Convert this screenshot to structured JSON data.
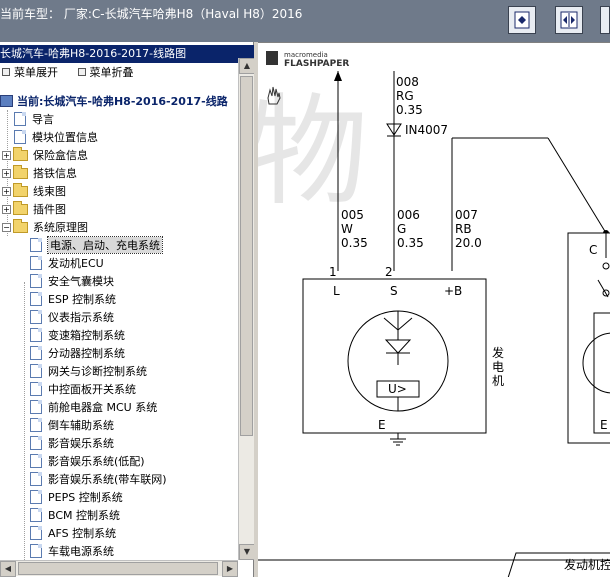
{
  "header": {
    "car_model": "当前车型： 厂家:C-长城汽车哈弗H8（Haval H8）2016"
  },
  "left_panel": {
    "title": "长城汽车-哈弗H8-2016-2017-线路图",
    "menu": {
      "expand_label": "菜单展开",
      "collapse_label": "菜单折叠"
    },
    "tree": {
      "root": "当前:长城汽车-哈弗H8-2016-2017-线路",
      "items": [
        "导言",
        "模块位置信息"
      ],
      "folders": [
        "保险盒信息",
        "搭铁信息",
        "线束图",
        "插件图",
        "系统原理图"
      ],
      "systems": [
        "电源、启动、充电系统",
        "发动机ECU",
        "安全气囊模块",
        "ESP 控制系统",
        "仪表指示系统",
        "变速箱控制系统",
        "分动器控制系统",
        "网关与诊断控制系统",
        "中控面板开关系统",
        "前舱电器盒 MCU 系统",
        "倒车辅助系统",
        "影音娱乐系统",
        "影音娱乐系统(低配)",
        "影音娱乐系统(带车联网)",
        "PEPS 控制系统",
        "BCM 控制系统",
        "AFS 控制系统",
        "车载电源系统"
      ]
    }
  },
  "viewer": {
    "logo_top": "macromedia",
    "logo_bottom": "FLASHPAPER",
    "wires": {
      "top_code": "008",
      "top_color": "RG",
      "top_size": "0.35",
      "diode": "IN4007",
      "w1_code": "005",
      "w1_color": "W",
      "w1_size": "0.35",
      "w2_code": "006",
      "w2_color": "G",
      "w2_size": "0.35",
      "w3_code": "007",
      "w3_color": "RB",
      "w3_size": "20.0"
    },
    "pins": {
      "p1": "1",
      "p2": "2",
      "L": "L",
      "S": "S",
      "B": "+B"
    },
    "component": {
      "regulator": "U>",
      "ground": "E",
      "name_1": "发",
      "name_2": "电",
      "name_3": "机"
    },
    "right_part": {
      "C": "C",
      "E": "E"
    },
    "footer_label": "发动机控"
  },
  "colors": {
    "topbar": "#6f7a8a",
    "tree_title_bg": "#0a246a",
    "folder": "#f2d36b"
  }
}
